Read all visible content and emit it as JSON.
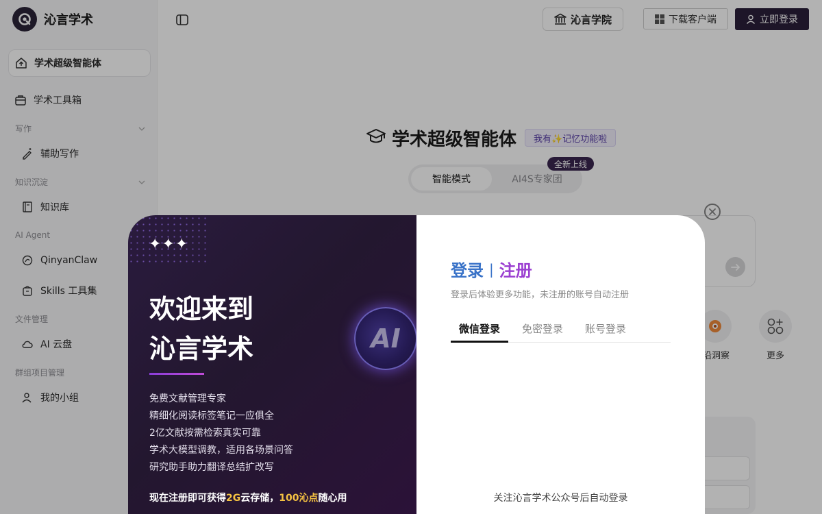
{
  "brand": {
    "name": "沁言学术"
  },
  "sidebar": {
    "items": [
      {
        "label": "学术超级智能体"
      },
      {
        "label": "学术工具箱"
      }
    ],
    "groups": [
      {
        "title": "写作",
        "items": [
          {
            "label": "辅助写作"
          }
        ]
      },
      {
        "title": "知识沉淀",
        "items": [
          {
            "label": "知识库"
          }
        ]
      },
      {
        "title": "AI Agent",
        "items": [
          {
            "label": "QinyanClaw"
          },
          {
            "label": "Skills 工具集"
          }
        ]
      },
      {
        "title": "文件管理",
        "items": [
          {
            "label": "AI 云盘"
          }
        ]
      },
      {
        "title": "群组项目管理",
        "items": [
          {
            "label": "我的小组"
          }
        ]
      }
    ]
  },
  "header": {
    "academy_label": "沁言学院",
    "download_label": "下载客户端",
    "login_label": "立即登录"
  },
  "main": {
    "title": "学术超级智能体",
    "memory_badge": "我有✨记忆功能啦",
    "mode_tabs": [
      {
        "label": "智能模式"
      },
      {
        "label": "AI4S专家团"
      }
    ],
    "new_badge": "全新上线",
    "quick_actions": [
      {
        "label": "沿洞察"
      },
      {
        "label": "更多"
      }
    ]
  },
  "modal": {
    "sparkles": "✦✦✦",
    "promo_title_line1": "欢迎来到",
    "promo_title_line2": "沁言学术",
    "features": [
      "免费文献管理专家",
      "精细化阅读标签笔记一应俱全",
      "2亿文献按需检索真实可靠",
      "学术大模型调教，适用各场景问答",
      "研究助手助力翻译总结扩改写"
    ],
    "promo_bottom": {
      "p1": "现在注册即可获得",
      "h1": "2G",
      "p2": "云存储，",
      "h2": "100沁点",
      "p3": "随心用"
    },
    "orb_text": "AI",
    "login_heading_login": "登录",
    "login_heading_sep": "|",
    "login_heading_register": "注册",
    "login_sub": "登录后体验更多功能，未注册的账号自动注册",
    "login_tabs": [
      {
        "label": "微信登录"
      },
      {
        "label": "免密登录"
      },
      {
        "label": "账号登录"
      }
    ],
    "qr_hint": "关注沁言学术公众号后自动登录"
  },
  "colors": {
    "brand_dark": "#2a1f3a",
    "promo_bg": "#23172f",
    "accent_blue": "#3a73c8",
    "accent_purple": "#9b3fd1",
    "highlight": "#f5c242"
  },
  "icons": [
    "q-logo-icon",
    "home-upload-icon",
    "briefcase-icon",
    "chevron-down-icon",
    "pen-sparkle-icon",
    "book-icon",
    "claw-icon",
    "box-icon",
    "cloud-icon",
    "users-icon",
    "sidebar-toggle-icon",
    "bank-icon",
    "windows-icon",
    "user-icon",
    "graduation-cap-icon",
    "arrow-right-icon",
    "close-icon",
    "grid-icon"
  ]
}
